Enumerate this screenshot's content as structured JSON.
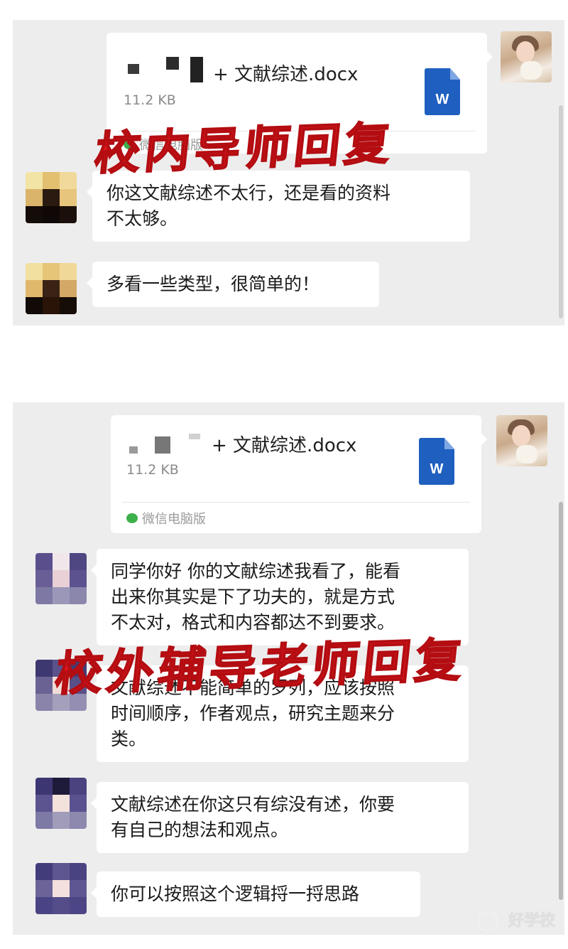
{
  "colors": {
    "panel_bg": "#ededed",
    "bubble_bg": "#ffffff",
    "stamp_red": "#d8161c",
    "word_blue": "#1f5fbf"
  },
  "chat1": {
    "file": {
      "name": "+ 文献综述.docx",
      "size": "11.2 KB",
      "type_icon": "W",
      "source": "微信电脑版"
    },
    "messages": [
      {
        "lines": [
          "你这文献综述不太行，还是看的资料",
          "不太够。"
        ]
      },
      {
        "lines": [
          "多看一些类型，很简单的！"
        ]
      }
    ],
    "stamp": "校内导师回复"
  },
  "chat2": {
    "file": {
      "name": "+ 文献综述.docx",
      "size": "11.2 KB",
      "type_icon": "W",
      "source": "微信电脑版"
    },
    "messages": [
      {
        "lines": [
          "同学你好  你的文献综述我看了，能看",
          "出来你其实是下了功夫的，就是方式",
          "不太对，格式和内容都达不到要求。"
        ]
      },
      {
        "lines": [
          "文献综述不能简单的罗列，应该按照",
          "时间顺序，作者观点，研究主题来分",
          "类。"
        ]
      },
      {
        "lines": [
          "文献综述在你这只有综没有述，你要",
          "有自己的想法和观点。"
        ]
      },
      {
        "lines": [
          "你可以按照这个逻辑捋一捋思路"
        ]
      }
    ],
    "stamp": "校外辅导老师回复"
  },
  "watermark": "好学校"
}
